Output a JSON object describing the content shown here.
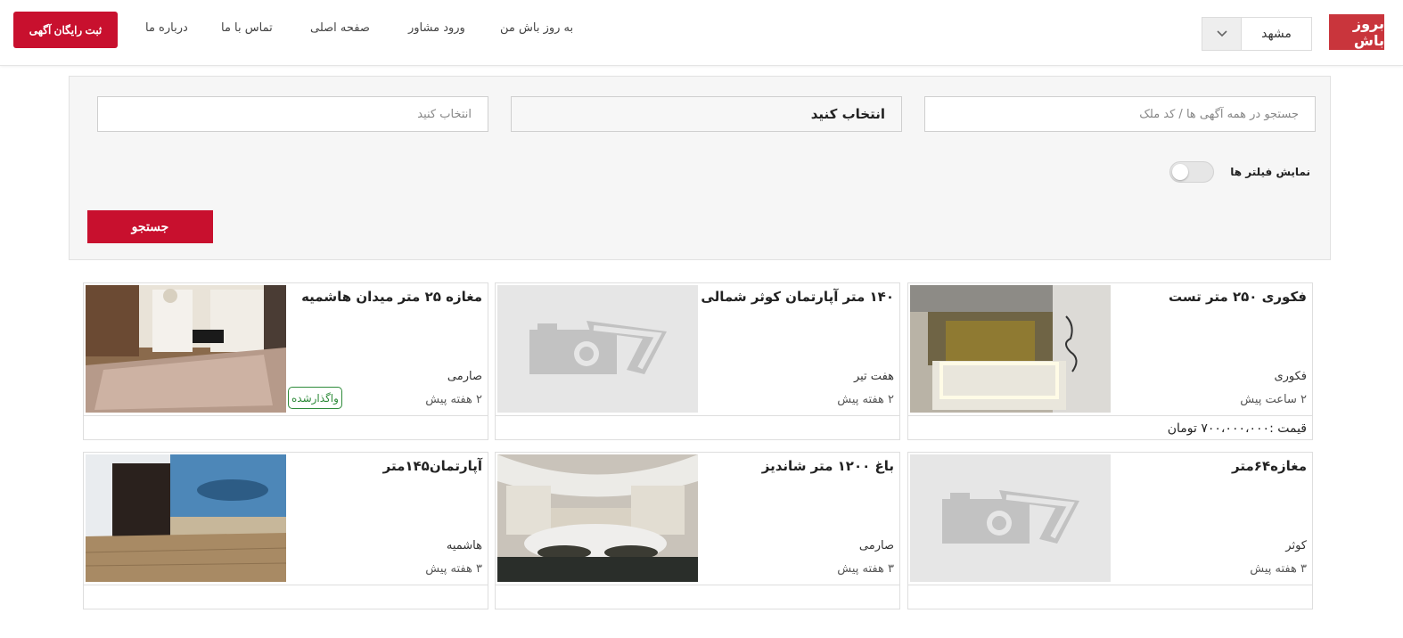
{
  "header": {
    "logo": "بروز باش",
    "city": "مشهد",
    "nav": [
      "به روز باش من",
      "ورود مشاور",
      "صفحه اصلی",
      "تماس با ما",
      "درباره ما"
    ],
    "cta": "ثبت رایگان آگهی"
  },
  "search": {
    "query_placeholder": "جستجو در همه آگهی ها / کد ملک",
    "select_value": "انتخاب کنید",
    "second_placeholder": "انتخاب کنید",
    "toggle_label": "نمایش فیلتر ها",
    "toggle_on": false,
    "button": "جستجو"
  },
  "listings": [
    {
      "title": "فکوری ۲۵۰ متر تست",
      "location": "فکوری",
      "time": "۲ ساعت پیش",
      "price": "قیمت :۷۰۰،۰۰۰،۰۰۰ تومان",
      "image": "bathroom-photo",
      "badge": ""
    },
    {
      "title": "۱۴۰ متر آپارتمان کوثر شمالی",
      "location": "هفت تیر",
      "time": "۲ هفته پیش",
      "price": "",
      "image": "placeholder",
      "badge": ""
    },
    {
      "title": "مغازه ۲۵ متر میدان هاشمیه",
      "location": "صارمی",
      "time": "۲ هفته پیش",
      "price": "",
      "image": "livingroom-photo",
      "badge": "واگذارشده"
    },
    {
      "title": "مغازه۶۴متر",
      "location": "کوثر",
      "time": "۳ هفته پیش",
      "price": "",
      "image": "placeholder",
      "badge": ""
    },
    {
      "title": "باغ ۱۲۰۰ متر شاندیز",
      "location": "صارمی",
      "time": "۳ هفته پیش",
      "price": "",
      "image": "bedroom-photo",
      "badge": ""
    },
    {
      "title": "آپارتمان۱۴۵متر",
      "location": "هاشمیه",
      "time": "۳ هفته پیش",
      "price": "",
      "image": "room-mural-photo",
      "badge": ""
    }
  ],
  "colors": {
    "brand_red": "#c8102e",
    "logo_red": "#c9353c",
    "badge_green": "#2e8b3a"
  }
}
